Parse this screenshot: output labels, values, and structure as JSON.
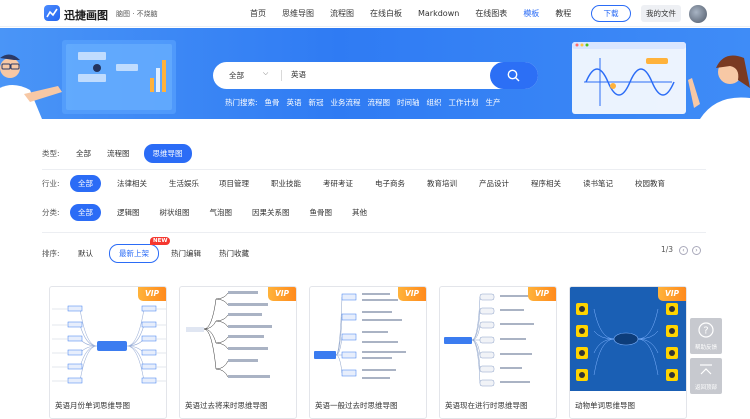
{
  "header": {
    "brand": "迅捷画图",
    "slogan": "脑图 · 不烧脑",
    "nav": [
      "首页",
      "思维导图",
      "流程图",
      "在线白板",
      "Markdown",
      "在线图表",
      "模板",
      "教程"
    ],
    "active_nav_index": 6,
    "download_label": "下载",
    "my_files_label": "我的文件"
  },
  "search": {
    "category": "全部",
    "query": "英语",
    "hot_label": "热门搜索:",
    "hot_terms": [
      "鱼骨",
      "英语",
      "新冠",
      "业务流程",
      "流程图",
      "时间轴",
      "组织",
      "工作计划",
      "生产"
    ]
  },
  "filters": {
    "type": {
      "label": "类型:",
      "items": [
        "全部",
        "流程图",
        "思维导图"
      ],
      "active": 2
    },
    "industry": {
      "label": "行业:",
      "items": [
        "全部",
        "法律相关",
        "生活娱乐",
        "项目管理",
        "职业技能",
        "考研考证",
        "电子商务",
        "教育培训",
        "产品设计",
        "程序相关",
        "读书笔记",
        "校园教育"
      ],
      "active": 0
    },
    "category": {
      "label": "分类:",
      "items": [
        "全部",
        "逻辑图",
        "树状组图",
        "气泡图",
        "因果关系图",
        "鱼骨图",
        "其他"
      ],
      "active": 0
    }
  },
  "sort": {
    "label": "排序:",
    "items": [
      "默认",
      "最新上架",
      "热门编辑",
      "热门收藏"
    ],
    "active": 1,
    "new_badge": "NEW",
    "pager": "1/3"
  },
  "cards": [
    {
      "title": "英语月份单词思维导图",
      "vip": "VIP"
    },
    {
      "title": "英语过去将来时思维导图",
      "vip": "VIP"
    },
    {
      "title": "英语一般过去时思维导图",
      "vip": "VIP"
    },
    {
      "title": "英语现在进行时思维导图",
      "vip": "VIP"
    },
    {
      "title": "动物单词思维导图",
      "vip": "VIP"
    }
  ],
  "side_tools": {
    "feedback": "帮助反馈",
    "top": "返回顶部"
  },
  "colors": {
    "accent": "#2b6cf6",
    "vip": "#ff9a2a",
    "banner": "#3a86f5"
  }
}
